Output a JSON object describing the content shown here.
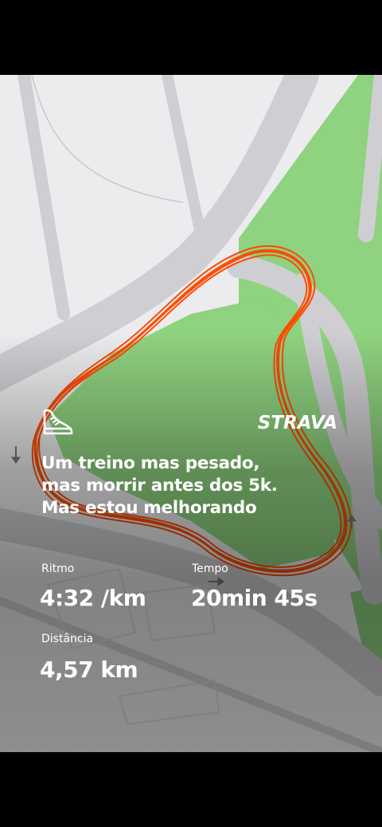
{
  "brand": {
    "name": "STRAVA",
    "activity_icon": "running-shoe-icon"
  },
  "caption": "Um treino mas pesado,\nmas morrir  antes dos 5k.\nMas estou melhorando",
  "stats": {
    "pace": {
      "label": "Ritmo",
      "value": "4:32 /km"
    },
    "time": {
      "label": "Tempo",
      "value": "20min 45s"
    },
    "distance": {
      "label": "Distância",
      "value": "4,57 km"
    }
  },
  "colors": {
    "route": "#fc4c02",
    "park": "#8fd27f",
    "road": "#cfcfd3",
    "background": "#000000"
  }
}
